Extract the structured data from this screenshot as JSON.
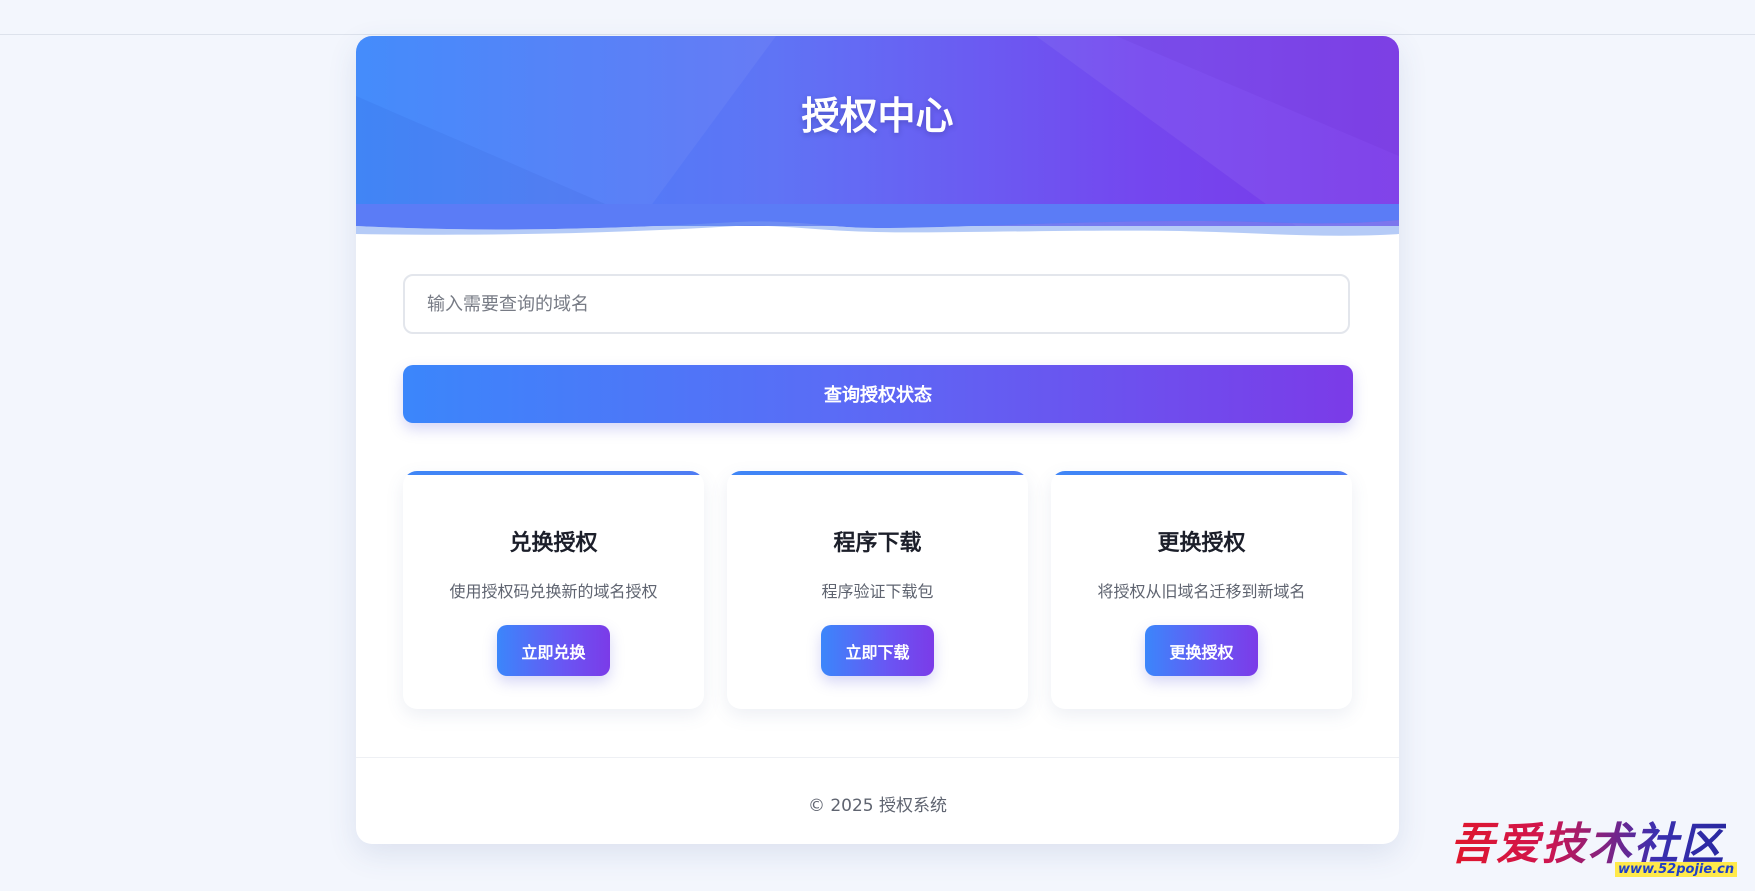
{
  "header": {
    "title": "授权中心"
  },
  "search": {
    "placeholder": "输入需要查询的域名",
    "value": ""
  },
  "query_button": {
    "label": "查询授权状态"
  },
  "features": [
    {
      "title": "兑换授权",
      "description": "使用授权码兑换新的域名授权",
      "button_label": "立即兑换"
    },
    {
      "title": "程序下载",
      "description": "程序验证下载包",
      "button_label": "立即下载"
    },
    {
      "title": "更换授权",
      "description": "将授权从旧域名迁移到新域名",
      "button_label": "更换授权"
    }
  ],
  "footer": {
    "text": "© 2025 授权系统"
  },
  "watermark": {
    "text": "吾爱技术社区",
    "url": "www.52pojie.cn"
  },
  "colors": {
    "page_background": "#f3f6fd",
    "gradient_start": "#3b86fb",
    "gradient_end": "#7b3be8",
    "card_background": "#ffffff",
    "feature_topbar": "#3f86f6"
  }
}
